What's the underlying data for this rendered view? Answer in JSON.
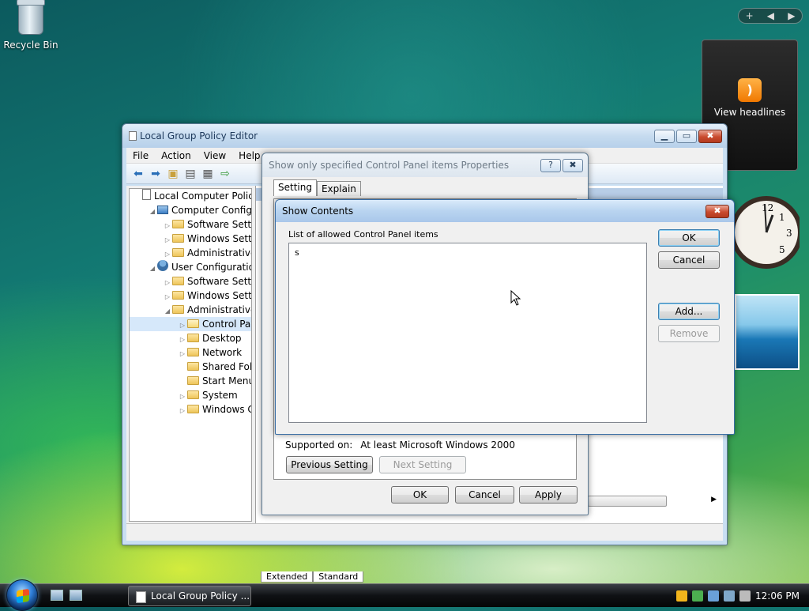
{
  "desktop": {
    "recycle_bin": "Recycle Bin"
  },
  "sidebar": {
    "controls": "+   ◀ ▶",
    "feed_label": "View headlines",
    "feed_icon": "rss-icon"
  },
  "gpe": {
    "title": "Local Group Policy Editor",
    "menus": [
      "File",
      "Action",
      "View",
      "Help"
    ],
    "tree": [
      {
        "label": "Local Computer Policy",
        "level": 0,
        "icon": "doc"
      },
      {
        "label": "Computer Configura",
        "level": 1,
        "icon": "comp",
        "twisty": "◢"
      },
      {
        "label": "Software Settings",
        "level": 2,
        "icon": "folder",
        "twisty": "▷"
      },
      {
        "label": "Windows Setting",
        "level": 2,
        "icon": "folder",
        "twisty": "▷"
      },
      {
        "label": "Administrative Te",
        "level": 2,
        "icon": "folder",
        "twisty": "▷"
      },
      {
        "label": "User Configuration",
        "level": 1,
        "icon": "user",
        "twisty": "◢"
      },
      {
        "label": "Software Settings",
        "level": 2,
        "icon": "folder",
        "twisty": "▷"
      },
      {
        "label": "Windows Setting",
        "level": 2,
        "icon": "folder",
        "twisty": "▷"
      },
      {
        "label": "Administrative Te",
        "level": 2,
        "icon": "folder",
        "twisty": "◢"
      },
      {
        "label": "Control Panel",
        "level": 3,
        "icon": "folder open",
        "twisty": "▷",
        "selected": true
      },
      {
        "label": "Desktop",
        "level": 3,
        "icon": "folder",
        "twisty": "▷"
      },
      {
        "label": "Network",
        "level": 3,
        "icon": "folder",
        "twisty": "▷"
      },
      {
        "label": "Shared Folder",
        "level": 3,
        "icon": "folder",
        "twisty": ""
      },
      {
        "label": "Start Menu ar",
        "level": 3,
        "icon": "folder",
        "twisty": ""
      },
      {
        "label": "System",
        "level": 3,
        "icon": "folder",
        "twisty": "▷"
      },
      {
        "label": "Windows Cor",
        "level": 3,
        "icon": "folder",
        "twisty": "▷"
      }
    ],
    "bottom_tabs": [
      "Extended",
      "Standard"
    ]
  },
  "props": {
    "title": "Show only specified Control Panel items Properties",
    "tabs": [
      "Setting",
      "Explain"
    ],
    "supported_label": "Supported on:",
    "supported_value": "At least Microsoft Windows 2000",
    "prev_label": "Previous Setting",
    "next_label": "Next Setting",
    "ok": "OK",
    "cancel": "Cancel",
    "apply": "Apply",
    "help_glyph": "?",
    "close_glyph": "✖"
  },
  "show": {
    "title": "Show Contents",
    "list_label": "List of allowed Control Panel items",
    "list_items": [
      "s"
    ],
    "ok": "OK",
    "cancel": "Cancel",
    "add": "Add...",
    "remove": "Remove"
  },
  "taskbar": {
    "task_label": "Local Group Policy ...",
    "clock": "12:06 PM"
  },
  "colors": {
    "accent": "#3c7fb1",
    "selection": "#d6e8fa",
    "close_red": "#c94a2e"
  }
}
